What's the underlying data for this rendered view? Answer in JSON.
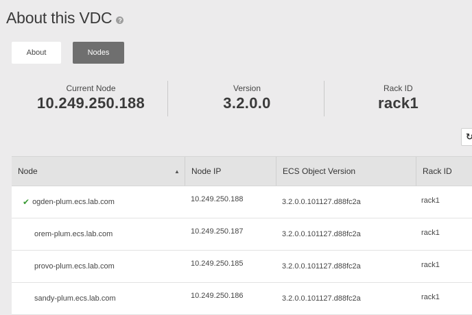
{
  "header": {
    "title": "About this VDC",
    "help_icon": "?"
  },
  "tabs": [
    {
      "label": "About",
      "active": false
    },
    {
      "label": "Nodes",
      "active": true
    }
  ],
  "summary": {
    "current_node": {
      "label": "Current Node",
      "value": "10.249.250.188"
    },
    "version": {
      "label": "Version",
      "value": "3.2.0.0"
    },
    "rack_id": {
      "label": "Rack ID",
      "value": "rack1"
    }
  },
  "toolbar": {
    "refresh_icon": "refresh-icon"
  },
  "table": {
    "columns": [
      "Node",
      "Node IP",
      "ECS Object Version",
      "Rack ID"
    ],
    "sort_indicator": "▲",
    "rows": [
      {
        "node": "ogden-plum.ecs.lab.com",
        "ip": "10.249.250.188",
        "version": "3.2.0.0.101127.d88fc2a",
        "rack": "rack1",
        "current": true
      },
      {
        "node": "orem-plum.ecs.lab.com",
        "ip": "10.249.250.187",
        "version": "3.2.0.0.101127.d88fc2a",
        "rack": "rack1",
        "current": false
      },
      {
        "node": "provo-plum.ecs.lab.com",
        "ip": "10.249.250.185",
        "version": "3.2.0.0.101127.d88fc2a",
        "rack": "rack1",
        "current": false
      },
      {
        "node": "sandy-plum.ecs.lab.com",
        "ip": "10.249.250.186",
        "version": "3.2.0.0.101127.d88fc2a",
        "rack": "rack1",
        "current": false
      }
    ]
  },
  "colors": {
    "check": "#3a9a35",
    "active_tab": "#6f6f6f",
    "background": "#ecebec"
  }
}
